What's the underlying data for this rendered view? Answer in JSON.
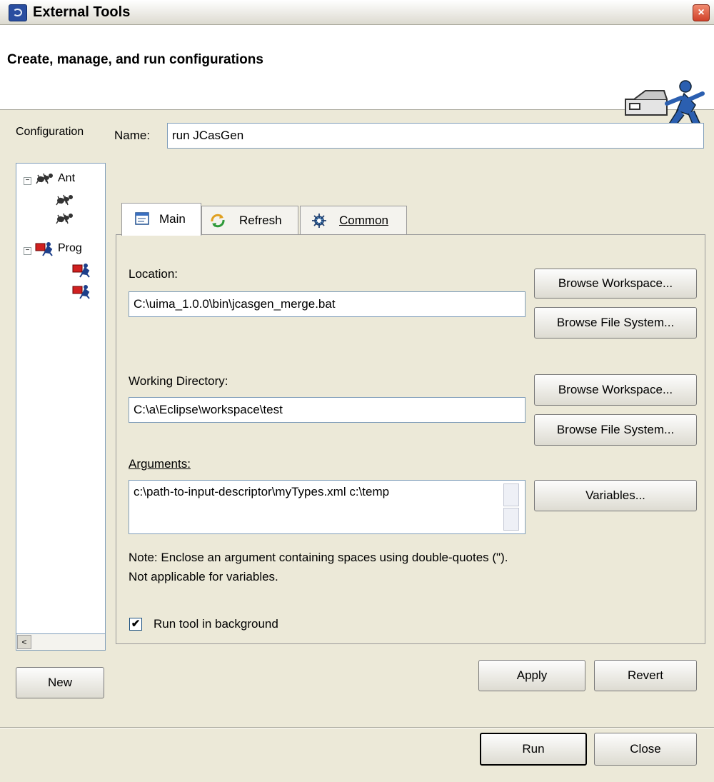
{
  "window": {
    "title": "External Tools",
    "close_glyph": "×"
  },
  "header": {
    "title": "Create, manage, and run configurations",
    "art_icon": "external-tools-runner-icon"
  },
  "left_panel": {
    "label": "Configuration",
    "tree": [
      {
        "label": "Ant",
        "icon": "ant-icon",
        "expanded": true
      },
      {
        "label": "",
        "icon": "ant-icon"
      },
      {
        "label": "",
        "icon": "ant-icon"
      },
      {
        "label": "Prog",
        "icon": "program-icon",
        "expanded": true
      },
      {
        "label": "",
        "icon": "program-icon"
      },
      {
        "label": "",
        "icon": "program-icon"
      }
    ],
    "scroll_left_glyph": "<",
    "new_button": "New"
  },
  "name": {
    "label": "Name:",
    "value": "run JCasGen"
  },
  "tabs": [
    {
      "label": "Main",
      "icon": "main-tab-icon",
      "active": true
    },
    {
      "label": "Refresh",
      "icon": "refresh-icon",
      "active": false
    },
    {
      "label": "Common",
      "icon": "common-icon",
      "active": false
    }
  ],
  "main": {
    "location_label": "Location:",
    "location_value": "C:\\uima_1.0.0\\bin\\jcasgen_merge.bat",
    "browse_workspace": "Browse Workspace...",
    "browse_file_system": "Browse File System...",
    "working_dir_label": "Working Directory:",
    "working_dir_value": "C:\\a\\Eclipse\\workspace\\test",
    "arguments_label": "Arguments:",
    "arguments_value": "c:\\path-to-input-descriptor\\myTypes.xml c:\\temp",
    "variables_button": "Variables...",
    "note_line1": "Note: Enclose an argument containing spaces using double-quotes (\").",
    "note_line2": "Not applicable for variables.",
    "run_background_label": "Run tool in background",
    "run_background_checked": true
  },
  "buttons": {
    "apply": "Apply",
    "revert": "Revert",
    "run": "Run",
    "close": "Close"
  }
}
